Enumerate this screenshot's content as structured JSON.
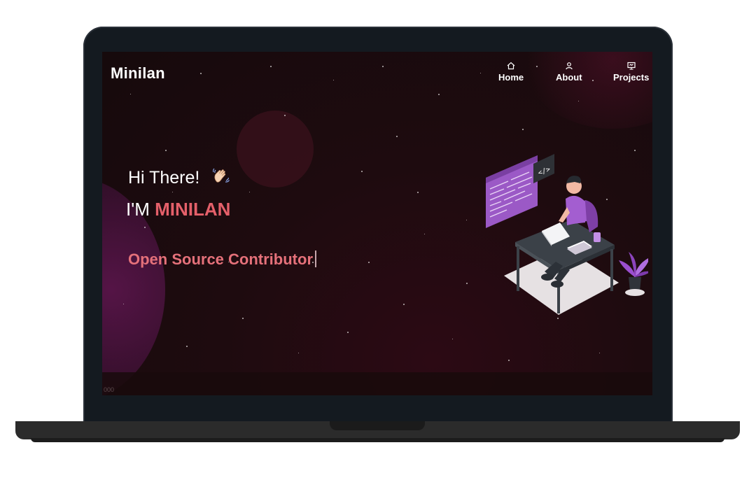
{
  "brand": {
    "logo": "Minilan"
  },
  "nav": {
    "items": [
      {
        "label": "Home",
        "icon": "home-icon"
      },
      {
        "label": "About",
        "icon": "user-icon"
      },
      {
        "label": "Projects",
        "icon": "projects-icon"
      }
    ]
  },
  "hero": {
    "greeting": "Hi There!",
    "greeting_emoji": "waving-hand-icon",
    "intro_prefix": "I'M ",
    "intro_name": "MINILAN",
    "typed_role": "Open Source Contributor"
  },
  "footer": {
    "text": "000"
  },
  "colors": {
    "accent": "#e5606a",
    "background": "#1e0b0f",
    "illustration_purple": "#9b59c6",
    "laptop_frame": "#141a20"
  }
}
